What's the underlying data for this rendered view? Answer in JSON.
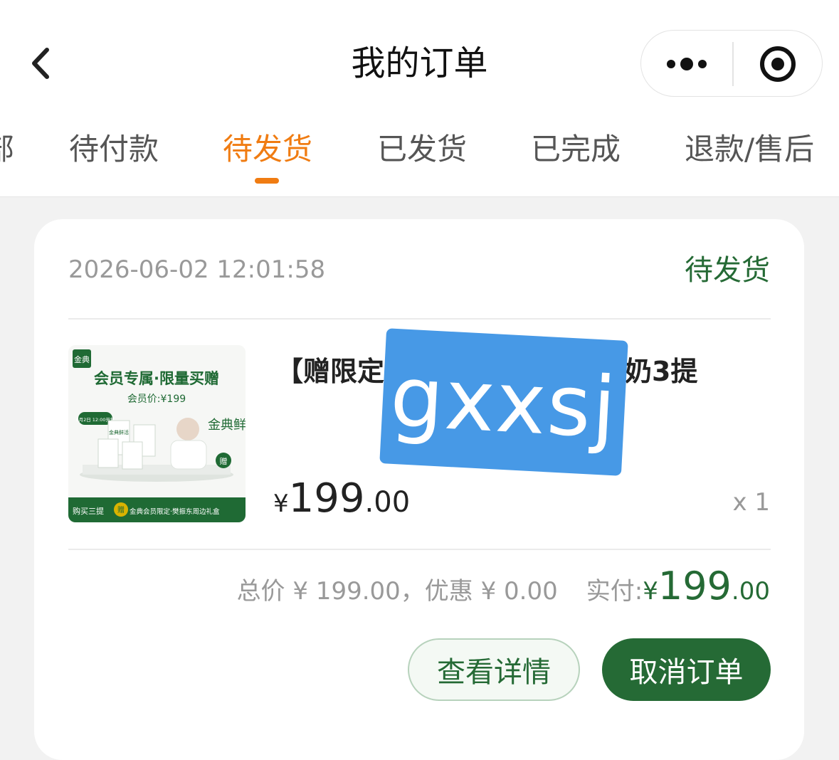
{
  "nav": {
    "back_icon": "chevron-left-icon",
    "title": "我的订单",
    "more_icon": "more-dots-icon",
    "close_icon": "target-circle-icon"
  },
  "tabs": {
    "partial_left": "部",
    "items": [
      "待付款",
      "待发货",
      "已发货",
      "已完成",
      "退款/售后"
    ],
    "active": "待发货",
    "accent_color": "#f07c12"
  },
  "order": {
    "time": "2026-06-02 12:01:58",
    "status": "待发货",
    "status_color": "#256a35",
    "product": {
      "name_prefix": "【赠限定",
      "name_suffix": "奶3提",
      "image_texts": {
        "brand": "金典",
        "headline": "会员专属·限量买赠",
        "member_price": "会员价:¥199",
        "date_badge": "6月2日 12:00开售",
        "pack_label": "金典鲜活",
        "gift_badge": "赠",
        "banner": "购买三提",
        "banner_gift": "赠",
        "banner_rest": "金典会员限定·樊振东周边礼盒"
      },
      "price_symbol": "¥",
      "price_int": "199",
      "price_dec": ".00",
      "quantity": "x 1"
    },
    "totals": {
      "total_text": "总价 ¥ 199.00，优惠 ¥ 0.00",
      "paid_label": "实付:",
      "paid_symbol": "¥",
      "paid_int": "199",
      "paid_dec": ".00"
    },
    "buttons": {
      "detail": "查看详情",
      "cancel": "取消订单"
    }
  },
  "watermark": {
    "text": "gxxsj",
    "color": "#4799e6"
  }
}
